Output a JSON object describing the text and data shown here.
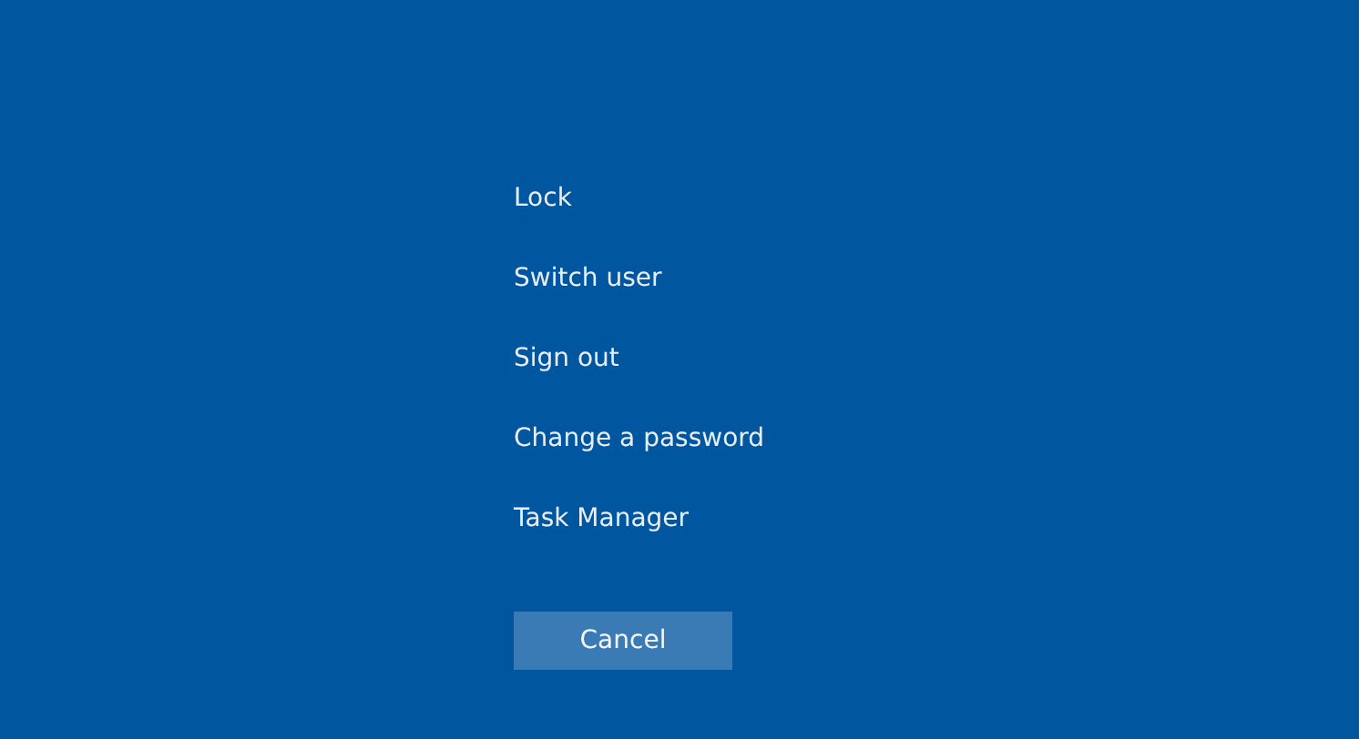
{
  "options": [
    {
      "label": "Lock"
    },
    {
      "label": "Switch user"
    },
    {
      "label": "Sign out"
    },
    {
      "label": "Change a password"
    },
    {
      "label": "Task Manager"
    }
  ],
  "cancel_button": {
    "label": "Cancel"
  }
}
